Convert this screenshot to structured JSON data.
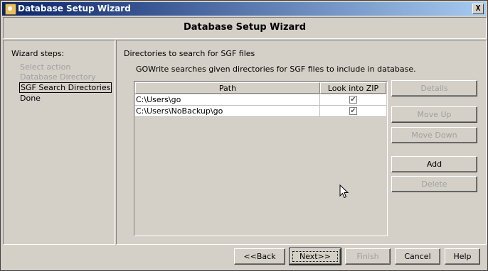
{
  "window": {
    "title": "Database Setup Wizard",
    "close_glyph": "X"
  },
  "header": {
    "title": "Database Setup Wizard"
  },
  "steps": {
    "heading": "Wizard steps:",
    "items": [
      {
        "label": "Select action",
        "state": "disabled"
      },
      {
        "label": "Database Directory",
        "state": "disabled"
      },
      {
        "label": "SGF Search Directories",
        "state": "current"
      },
      {
        "label": "Done",
        "state": "normal"
      }
    ]
  },
  "main": {
    "heading": "Directories to search for SGF files",
    "description": "GOWrite searches given directories for SGF files to include in database.",
    "table": {
      "columns": [
        "Path",
        "Look into ZIP files"
      ],
      "rows": [
        {
          "path": "C:\\Users\\go",
          "zip": true
        },
        {
          "path": "C:\\Users\\NoBackup\\go",
          "zip": true
        }
      ]
    },
    "side_buttons": {
      "details": "Details",
      "move_up": "Move Up",
      "move_down": "Move Down",
      "add": "Add",
      "delete": "Delete"
    }
  },
  "footer": {
    "back": "<<Back",
    "next": "Next>>",
    "finish": "Finish",
    "cancel": "Cancel",
    "help": "Help"
  },
  "icons": {
    "checkmark": "✔",
    "app": "database-wizard-icon"
  },
  "colors": {
    "titlebar_start": "#0a246a",
    "titlebar_end": "#a6caf0",
    "face": "#d4d0c8",
    "disabled_text": "#a0a0a0"
  }
}
